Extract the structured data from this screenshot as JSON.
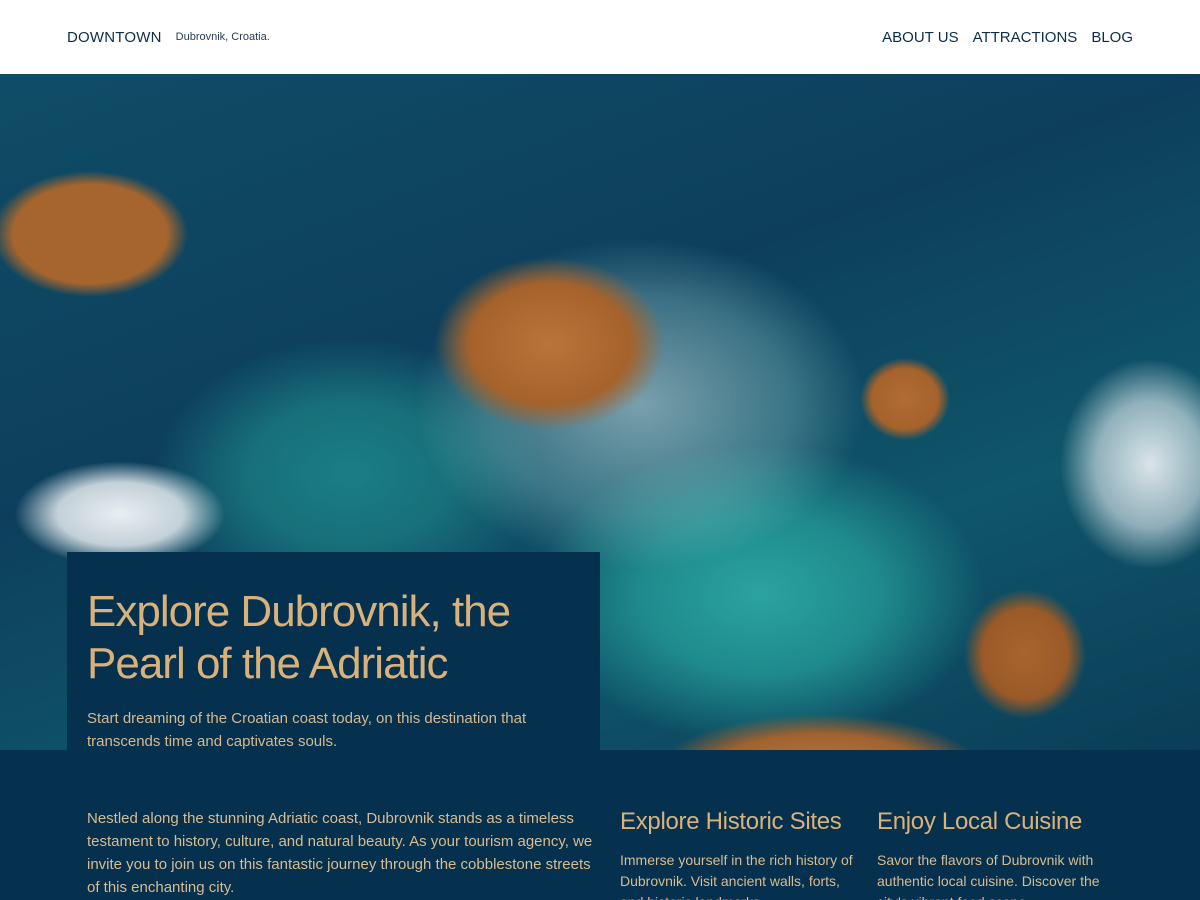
{
  "header": {
    "brand": "DOWNTOWN",
    "tagline": "Dubrovnik, Croatia.",
    "nav": [
      "ABOUT US",
      "ATTRACTIONS",
      "BLOG"
    ]
  },
  "hero": {
    "title": "Explore Dubrovnik, the Pearl of the Adriatic",
    "subtitle": "Start dreaming of the Croatian coast today, on this destination that transcends time and captivates souls."
  },
  "content": {
    "intro": "Nestled along the stunning Adriatic coast, Dubrovnik stands as a timeless testament to history, culture, and natural beauty. As your tourism agency, we invite you to join us on this fantastic journey through the cobblestone streets of this enchanting city.",
    "features": [
      {
        "title": "Explore Historic Sites",
        "text": "Immerse yourself in the rich history of Dubrovnik. Visit ancient walls, forts, and historic landmarks."
      },
      {
        "title": "Enjoy Local Cuisine",
        "text": "Savor the flavors of Dubrovnik with authentic local cuisine. Discover the city's vibrant food scene."
      }
    ]
  },
  "colors": {
    "navy": "#05304e",
    "gold": "#d8b27a",
    "header_bg": "#ffffff"
  }
}
